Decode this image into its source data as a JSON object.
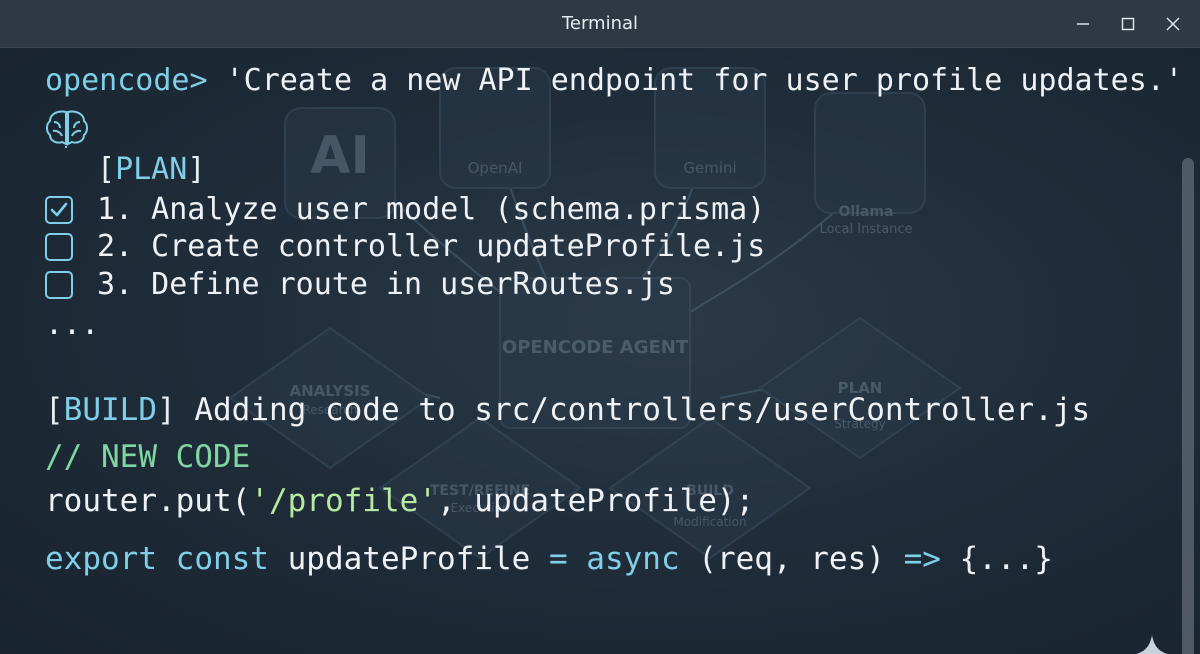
{
  "window": {
    "title": "Terminal"
  },
  "terminal": {
    "prompt": "opencode>",
    "command": " 'Create a new API endpoint for user profile updates.'",
    "plan_open": "[",
    "plan_tag": "PLAN",
    "plan_close": "]",
    "steps": [
      {
        "text": "1. Analyze user model (schema.prisma)",
        "checked": true
      },
      {
        "text": "2. Create controller updateProfile.js",
        "checked": false
      },
      {
        "text": "3. Define route in userRoutes.js",
        "checked": false
      }
    ],
    "ellipsis": "...",
    "build_open": "[",
    "build_tag": "BUILD",
    "build_close": "]",
    "build_text": " Adding code to src/controllers/userController.js",
    "comment": "// NEW CODE",
    "router_pre": "router.put(",
    "router_string": "'/profile'",
    "router_post": ", updateProfile);",
    "export_kw1": "export",
    "export_kw2": "const",
    "export_name": " updateProfile ",
    "export_eq": "=",
    "export_kw3": "async",
    "export_args": " (req, res) ",
    "export_arrow": "=>",
    "export_body": " {...}"
  },
  "background": {
    "providers": [
      "AI",
      "OpenAI",
      "Gemini",
      "Ollama"
    ],
    "ollama_sub": "Local Instance",
    "center_label": "OPENCODE AGENT",
    "nodes": [
      "ANALYSIS",
      "PLAN",
      "TEST/REFINE",
      "BUILD"
    ],
    "node_subs": [
      "Research",
      "Strategy",
      "Execution",
      "Modification"
    ]
  },
  "colors": {
    "accent": "#7fcfe8",
    "comment": "#7fd6a0",
    "text": "#eef2f6"
  }
}
